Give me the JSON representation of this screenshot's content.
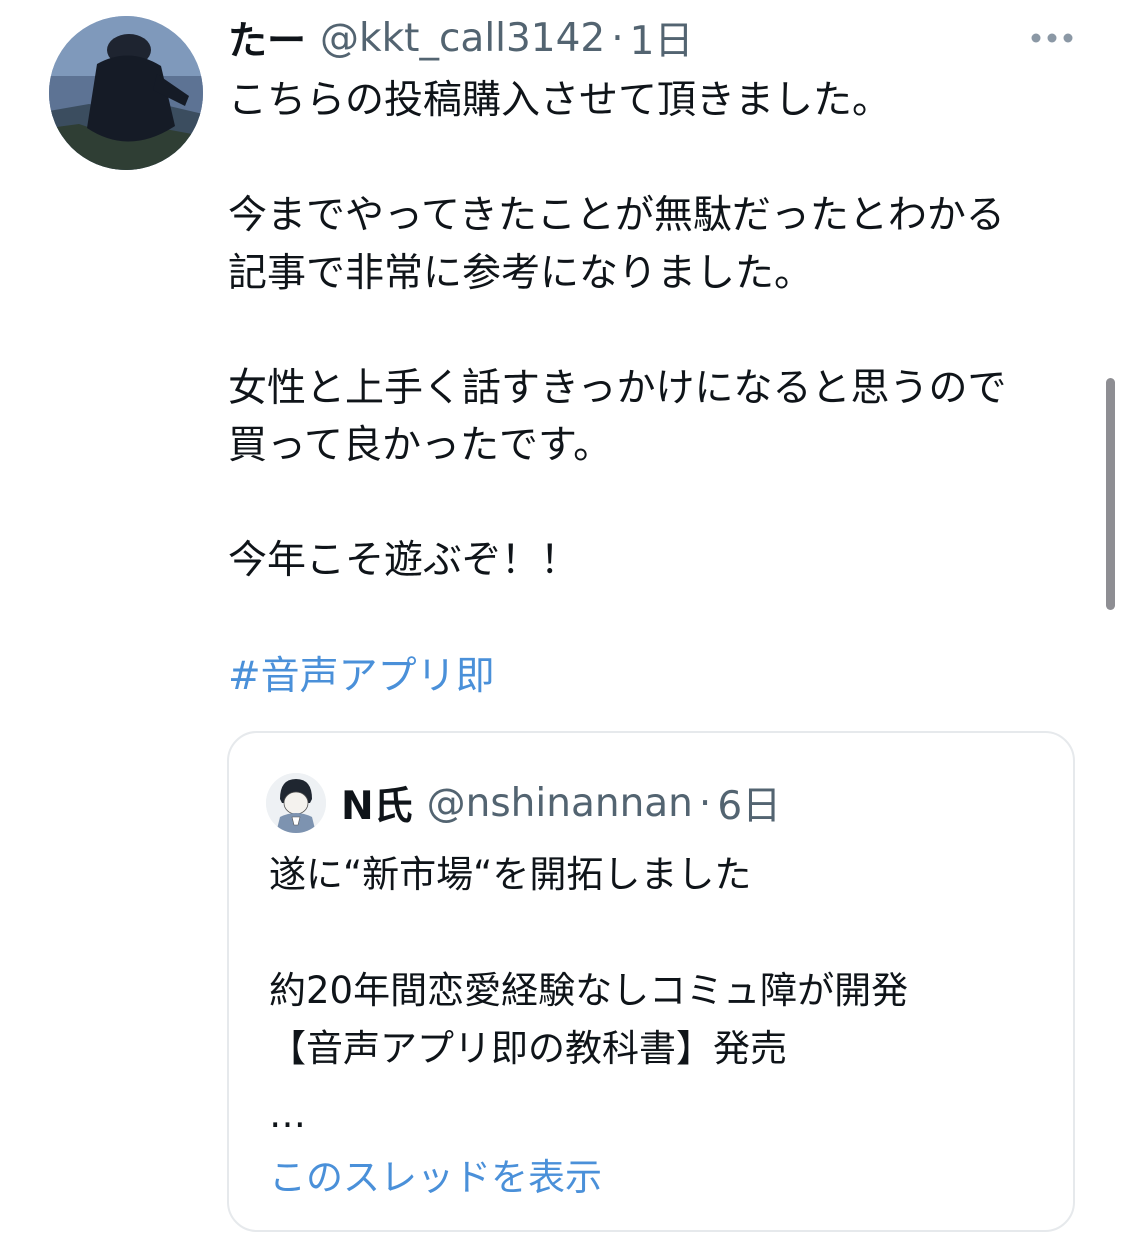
{
  "tweet": {
    "display_name": "たー",
    "handle": "@kkt_call3142",
    "separator": "·",
    "time": "1日",
    "more_icon": "more-horizontal-icon",
    "body": "こちらの投稿購入させて頂きました。\n\n今までやってきたことが無駄だったとわかる\n記事で非常に参考になりました。\n\n女性と上手く話すきっかけになると思うので\n買って良かったです。\n\n今年こそ遊ぶぞ！！",
    "hashtag": "#音声アプリ即"
  },
  "quote": {
    "display_name": "N氏",
    "handle": "@nshinannan",
    "separator": "·",
    "time": "6日",
    "body": "遂に“新市場“を開拓しました\n\n約20年間恋愛経験なしコミュ障が開発\n【音声アプリ即の教科書】発売",
    "ellipsis": "…",
    "show_thread": "このスレッドを表示"
  },
  "colors": {
    "link": "#4a90d9",
    "text": "#0f1419",
    "secondary": "#536471",
    "border": "#e6e9ec"
  }
}
